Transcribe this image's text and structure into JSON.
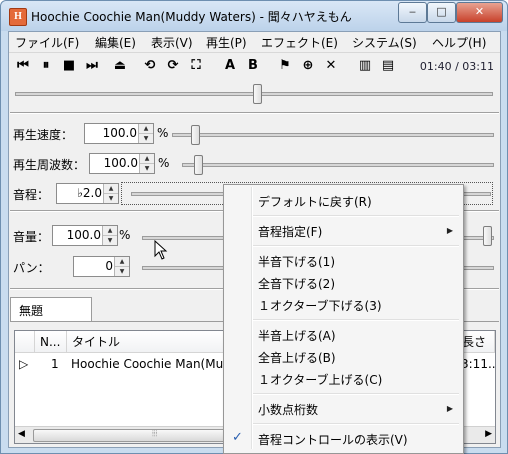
{
  "window": {
    "title": "Hoochie Coochie Man(Muddy Waters) - 聞々ハヤえもん",
    "app_icon_letter": "H"
  },
  "title_buttons": {
    "minimize": "‒",
    "maximize": "□",
    "close": "✕"
  },
  "menu": [
    "ファイル(F)",
    "編集(E)",
    "表示(V)",
    "再生(P)",
    "エフェクト(E)",
    "システム(S)",
    "ヘルプ(H)"
  ],
  "toolbar": {
    "buttons": [
      "⏮",
      "⏸",
      "■",
      "⏭",
      "⏏",
      "⟲",
      "⟳",
      "⛶",
      "A",
      "B",
      "⚑",
      "⊕",
      "✕",
      "▥",
      "▤"
    ],
    "time": "01:40 / 03:11"
  },
  "position_level": 0.51,
  "controls": {
    "speed": {
      "label": "再生速度：",
      "value": "100.0",
      "unit": "%",
      "level": 0.06
    },
    "frequency": {
      "label": "再生周波数：",
      "value": "100.0",
      "unit": "%",
      "level": 0.04
    },
    "pitch": {
      "label": "音程：",
      "value": "♭2.0"
    },
    "volume": {
      "label": "音量：",
      "value": "100.0",
      "unit": "%",
      "level": 1.0
    },
    "pan": {
      "label": "パン：",
      "value": "0",
      "level": 0.5
    }
  },
  "playlist": {
    "tab": "無題",
    "columns": [
      "N...",
      "タイトル",
      "長さ"
    ],
    "rows": [
      {
        "marker": "▷",
        "n": "1",
        "title": "Hoochie Coochie Man(Muddy Waters)",
        "length": "3:11..."
      }
    ],
    "scroll_left": "◀",
    "scroll_grip": "⦙⦙⦙",
    "scroll_right": "▶"
  },
  "context_menu": {
    "items": [
      {
        "label": "デフォルトに戻す(R)"
      },
      {
        "label": "音程指定(F)",
        "submenu_arrow": "▶"
      },
      {
        "label": "半音下げる(1)"
      },
      {
        "label": "全音下げる(2)"
      },
      {
        "label": "１オクターブ下げる(3)"
      },
      {
        "label": "半音上げる(A)"
      },
      {
        "label": "全音上げる(B)"
      },
      {
        "label": "１オクターブ上げる(C)"
      },
      {
        "label": "小数点桁数",
        "submenu_arrow": "▶"
      },
      {
        "label": "音程コントロールの表示(V)",
        "check": "✓"
      }
    ]
  },
  "colors": {
    "accent_check": "#2a5fb0",
    "title_gradient_top": "#d9e7f6",
    "close_button": "#c8412b"
  }
}
